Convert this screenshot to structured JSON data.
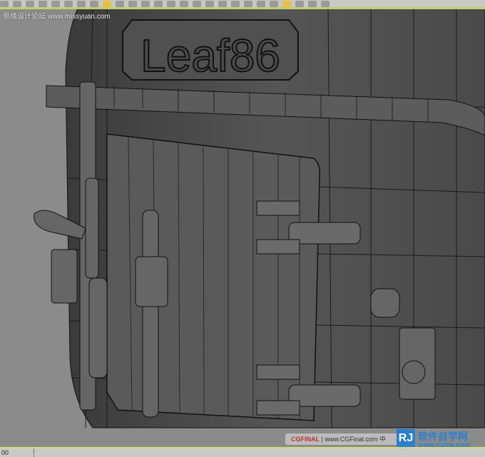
{
  "watermark_top": "思缘设计论坛 www.missyuan.com",
  "model": {
    "plate_text": "Leaf86"
  },
  "status": {
    "left_text": "00"
  },
  "watermark_bottom": {
    "brand": "CGFINAL",
    "text": "| www.CGFinal.com 中",
    "logo_letters": "RJ",
    "site_title": "软件自学网",
    "site_url": "www.rjzxw.com"
  },
  "colors": {
    "viewport": "#8b8b8b",
    "model": "#4a4a4a",
    "accent_line": "#c4cc70"
  }
}
